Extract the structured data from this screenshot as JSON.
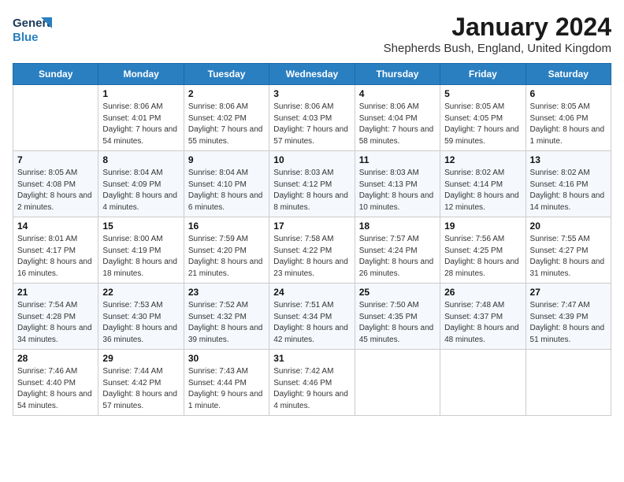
{
  "app": {
    "logo_line1": "General",
    "logo_line2": "Blue"
  },
  "header": {
    "title": "January 2024",
    "subtitle": "Shepherds Bush, England, United Kingdom"
  },
  "days_of_week": [
    "Sunday",
    "Monday",
    "Tuesday",
    "Wednesday",
    "Thursday",
    "Friday",
    "Saturday"
  ],
  "weeks": [
    [
      {
        "day": "",
        "sunrise": "",
        "sunset": "",
        "daylight": ""
      },
      {
        "day": "1",
        "sunrise": "Sunrise: 8:06 AM",
        "sunset": "Sunset: 4:01 PM",
        "daylight": "Daylight: 7 hours and 54 minutes."
      },
      {
        "day": "2",
        "sunrise": "Sunrise: 8:06 AM",
        "sunset": "Sunset: 4:02 PM",
        "daylight": "Daylight: 7 hours and 55 minutes."
      },
      {
        "day": "3",
        "sunrise": "Sunrise: 8:06 AM",
        "sunset": "Sunset: 4:03 PM",
        "daylight": "Daylight: 7 hours and 57 minutes."
      },
      {
        "day": "4",
        "sunrise": "Sunrise: 8:06 AM",
        "sunset": "Sunset: 4:04 PM",
        "daylight": "Daylight: 7 hours and 58 minutes."
      },
      {
        "day": "5",
        "sunrise": "Sunrise: 8:05 AM",
        "sunset": "Sunset: 4:05 PM",
        "daylight": "Daylight: 7 hours and 59 minutes."
      },
      {
        "day": "6",
        "sunrise": "Sunrise: 8:05 AM",
        "sunset": "Sunset: 4:06 PM",
        "daylight": "Daylight: 8 hours and 1 minute."
      }
    ],
    [
      {
        "day": "7",
        "sunrise": "Sunrise: 8:05 AM",
        "sunset": "Sunset: 4:08 PM",
        "daylight": "Daylight: 8 hours and 2 minutes."
      },
      {
        "day": "8",
        "sunrise": "Sunrise: 8:04 AM",
        "sunset": "Sunset: 4:09 PM",
        "daylight": "Daylight: 8 hours and 4 minutes."
      },
      {
        "day": "9",
        "sunrise": "Sunrise: 8:04 AM",
        "sunset": "Sunset: 4:10 PM",
        "daylight": "Daylight: 8 hours and 6 minutes."
      },
      {
        "day": "10",
        "sunrise": "Sunrise: 8:03 AM",
        "sunset": "Sunset: 4:12 PM",
        "daylight": "Daylight: 8 hours and 8 minutes."
      },
      {
        "day": "11",
        "sunrise": "Sunrise: 8:03 AM",
        "sunset": "Sunset: 4:13 PM",
        "daylight": "Daylight: 8 hours and 10 minutes."
      },
      {
        "day": "12",
        "sunrise": "Sunrise: 8:02 AM",
        "sunset": "Sunset: 4:14 PM",
        "daylight": "Daylight: 8 hours and 12 minutes."
      },
      {
        "day": "13",
        "sunrise": "Sunrise: 8:02 AM",
        "sunset": "Sunset: 4:16 PM",
        "daylight": "Daylight: 8 hours and 14 minutes."
      }
    ],
    [
      {
        "day": "14",
        "sunrise": "Sunrise: 8:01 AM",
        "sunset": "Sunset: 4:17 PM",
        "daylight": "Daylight: 8 hours and 16 minutes."
      },
      {
        "day": "15",
        "sunrise": "Sunrise: 8:00 AM",
        "sunset": "Sunset: 4:19 PM",
        "daylight": "Daylight: 8 hours and 18 minutes."
      },
      {
        "day": "16",
        "sunrise": "Sunrise: 7:59 AM",
        "sunset": "Sunset: 4:20 PM",
        "daylight": "Daylight: 8 hours and 21 minutes."
      },
      {
        "day": "17",
        "sunrise": "Sunrise: 7:58 AM",
        "sunset": "Sunset: 4:22 PM",
        "daylight": "Daylight: 8 hours and 23 minutes."
      },
      {
        "day": "18",
        "sunrise": "Sunrise: 7:57 AM",
        "sunset": "Sunset: 4:24 PM",
        "daylight": "Daylight: 8 hours and 26 minutes."
      },
      {
        "day": "19",
        "sunrise": "Sunrise: 7:56 AM",
        "sunset": "Sunset: 4:25 PM",
        "daylight": "Daylight: 8 hours and 28 minutes."
      },
      {
        "day": "20",
        "sunrise": "Sunrise: 7:55 AM",
        "sunset": "Sunset: 4:27 PM",
        "daylight": "Daylight: 8 hours and 31 minutes."
      }
    ],
    [
      {
        "day": "21",
        "sunrise": "Sunrise: 7:54 AM",
        "sunset": "Sunset: 4:28 PM",
        "daylight": "Daylight: 8 hours and 34 minutes."
      },
      {
        "day": "22",
        "sunrise": "Sunrise: 7:53 AM",
        "sunset": "Sunset: 4:30 PM",
        "daylight": "Daylight: 8 hours and 36 minutes."
      },
      {
        "day": "23",
        "sunrise": "Sunrise: 7:52 AM",
        "sunset": "Sunset: 4:32 PM",
        "daylight": "Daylight: 8 hours and 39 minutes."
      },
      {
        "day": "24",
        "sunrise": "Sunrise: 7:51 AM",
        "sunset": "Sunset: 4:34 PM",
        "daylight": "Daylight: 8 hours and 42 minutes."
      },
      {
        "day": "25",
        "sunrise": "Sunrise: 7:50 AM",
        "sunset": "Sunset: 4:35 PM",
        "daylight": "Daylight: 8 hours and 45 minutes."
      },
      {
        "day": "26",
        "sunrise": "Sunrise: 7:48 AM",
        "sunset": "Sunset: 4:37 PM",
        "daylight": "Daylight: 8 hours and 48 minutes."
      },
      {
        "day": "27",
        "sunrise": "Sunrise: 7:47 AM",
        "sunset": "Sunset: 4:39 PM",
        "daylight": "Daylight: 8 hours and 51 minutes."
      }
    ],
    [
      {
        "day": "28",
        "sunrise": "Sunrise: 7:46 AM",
        "sunset": "Sunset: 4:40 PM",
        "daylight": "Daylight: 8 hours and 54 minutes."
      },
      {
        "day": "29",
        "sunrise": "Sunrise: 7:44 AM",
        "sunset": "Sunset: 4:42 PM",
        "daylight": "Daylight: 8 hours and 57 minutes."
      },
      {
        "day": "30",
        "sunrise": "Sunrise: 7:43 AM",
        "sunset": "Sunset: 4:44 PM",
        "daylight": "Daylight: 9 hours and 1 minute."
      },
      {
        "day": "31",
        "sunrise": "Sunrise: 7:42 AM",
        "sunset": "Sunset: 4:46 PM",
        "daylight": "Daylight: 9 hours and 4 minutes."
      },
      {
        "day": "",
        "sunrise": "",
        "sunset": "",
        "daylight": ""
      },
      {
        "day": "",
        "sunrise": "",
        "sunset": "",
        "daylight": ""
      },
      {
        "day": "",
        "sunrise": "",
        "sunset": "",
        "daylight": ""
      }
    ]
  ]
}
